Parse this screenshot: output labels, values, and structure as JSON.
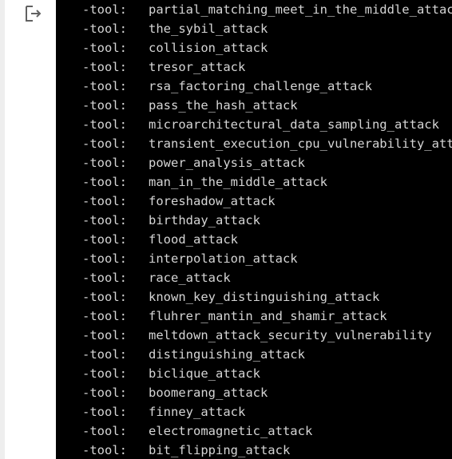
{
  "output": {
    "icon": "output-arrow-icon",
    "prefix": "-tool:",
    "lines": [
      "partial_matching_meet_in_the_middle_attac",
      "the_sybil_attack",
      "collision_attack",
      "tresor_attack",
      "rsa_factoring_challenge_attack",
      "pass_the_hash_attack",
      "microarchitectural_data_sampling_attack",
      "transient_execution_cpu_vulnerability_att",
      "power_analysis_attack",
      "man_in_the_middle_attack",
      "foreshadow_attack",
      "birthday_attack",
      "flood_attack",
      "interpolation_attack",
      "race_attack",
      "known_key_distinguishing_attack",
      "fluhrer_mantin_and_shamir_attack",
      "meltdown_attack_security_vulnerability",
      "distinguishing_attack",
      "biclique_attack",
      "boomerang_attack",
      "finney_attack",
      "electromagnetic_attack",
      "bit_flipping_attack"
    ]
  },
  "colors": {
    "output_background": "#000000",
    "output_text": "#d5d5d5",
    "gutter_background": "#ffffff",
    "icon": "#616161"
  }
}
